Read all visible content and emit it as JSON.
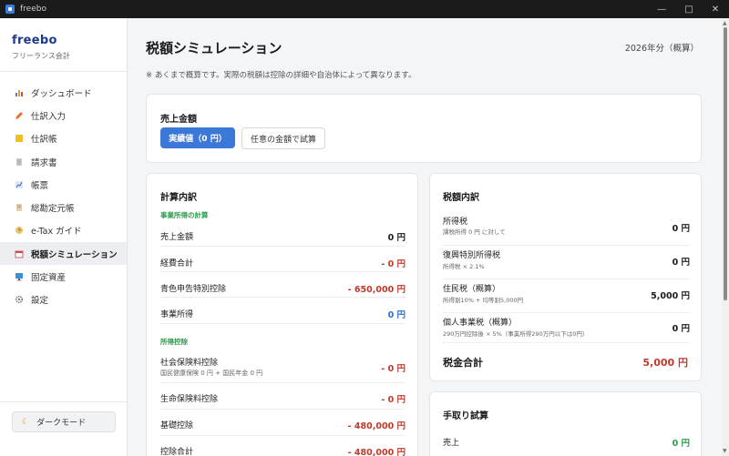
{
  "window": {
    "title": "freebo"
  },
  "sidebar": {
    "brand": "freebo",
    "subtitle": "フリーランス会計",
    "items": [
      {
        "label": "ダッシュボード",
        "icon": "bar-chart-icon"
      },
      {
        "label": "仕訳入力",
        "icon": "pencil-icon"
      },
      {
        "label": "仕訳帳",
        "icon": "notebook-icon"
      },
      {
        "label": "請求書",
        "icon": "document-icon"
      },
      {
        "label": "帳票",
        "icon": "chart-icon"
      },
      {
        "label": "総勘定元帳",
        "icon": "ledger-icon"
      },
      {
        "label": "e-Tax ガイド",
        "icon": "clock-icon"
      },
      {
        "label": "税額シミュレーション",
        "icon": "calendar-icon"
      },
      {
        "label": "固定資産",
        "icon": "monitor-icon"
      },
      {
        "label": "設定",
        "icon": "gear-icon"
      }
    ],
    "active_index": 7,
    "dark_mode_label": "ダークモード"
  },
  "main": {
    "title": "税額シミュレーション",
    "period": "2026年分（概算）",
    "note": "※ あくまで概算です。実際の税額は控除の詳細や自治体によって異なります。",
    "sales": {
      "title": "売上金額",
      "actual_button": "実績値（0 円）",
      "custom_button": "任意の金額で試算"
    },
    "calc": {
      "title": "計算内訳",
      "section1": "事業所得の計算",
      "rows1": [
        {
          "label": "売上金額",
          "value": "0 円",
          "color": "black"
        },
        {
          "label": "経費合計",
          "value": "- 0 円",
          "color": "red"
        },
        {
          "label": "青色申告特別控除",
          "value": "- 650,000 円",
          "color": "red"
        },
        {
          "label": "事業所得",
          "value": "0 円",
          "color": "blue"
        }
      ],
      "section2": "所得控除",
      "rows2": [
        {
          "label": "社会保険料控除",
          "sub": "国民健康保険 0 円 + 国民年金 0 円",
          "value": "- 0 円",
          "color": "red"
        },
        {
          "label": "生命保険料控除",
          "value": "- 0 円",
          "color": "red"
        },
        {
          "label": "基礎控除",
          "value": "- 480,000 円",
          "color": "red"
        },
        {
          "label": "控除合計",
          "value": "- 480,000 円",
          "color": "red"
        }
      ]
    },
    "tax": {
      "title": "税額内訳",
      "rows": [
        {
          "label": "所得税",
          "sub": "課税所得 0 円 に対して",
          "value": "0 円"
        },
        {
          "label": "復興特別所得税",
          "sub": "所得税 × 2.1%",
          "value": "0 円"
        },
        {
          "label": "住民税（概算）",
          "sub": "所得割10% + 均等割5,000円",
          "value": "5,000 円"
        },
        {
          "label": "個人事業税（概算）",
          "sub": "290万円控除後 × 5%（事業所得290万円以下は0円）",
          "value": "0 円"
        }
      ],
      "total_label": "税金合計",
      "total_value": "5,000 円"
    },
    "net": {
      "title": "手取り試算",
      "row_label": "売上",
      "row_value": "0 円"
    }
  }
}
